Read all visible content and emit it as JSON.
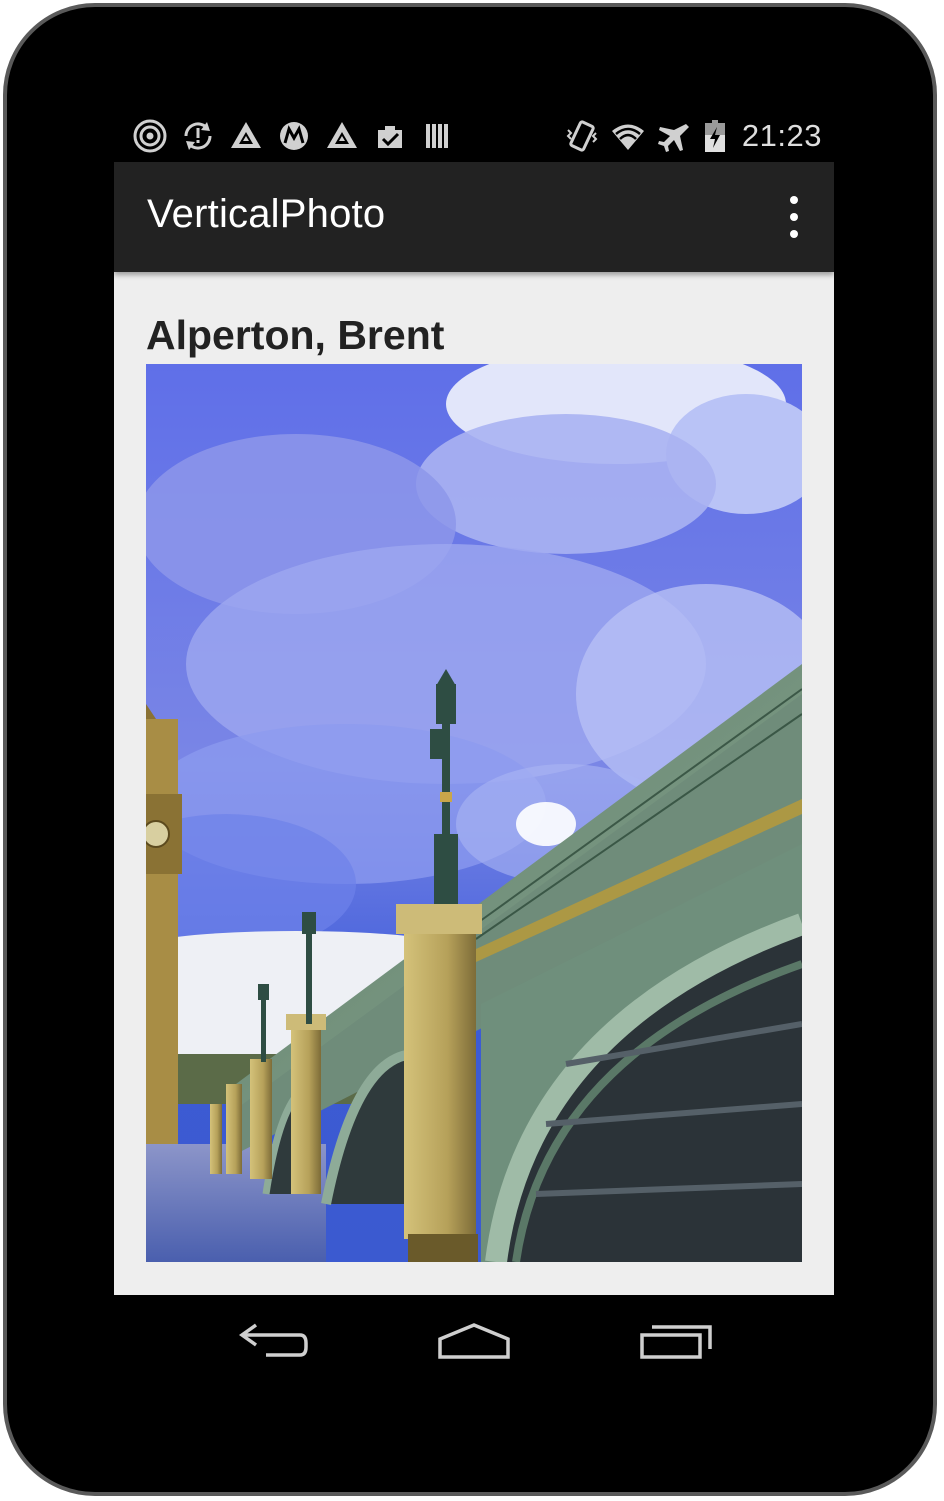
{
  "status_bar": {
    "left_icons": [
      "target-icon",
      "sync-alert-icon",
      "drive-icon",
      "motorola-icon",
      "drive-icon",
      "clipboard-check-icon",
      "barcode-icon"
    ],
    "right_icons": [
      "vibrate-icon",
      "wifi-icon",
      "airplane-mode-icon",
      "battery-charging-icon"
    ],
    "time": "21:23"
  },
  "action_bar": {
    "title": "VerticalPhoto",
    "overflow_icon": "more-vert-icon",
    "background": "#222222"
  },
  "content": {
    "place_title": "Alperton, Brent",
    "photo_subject": "westminster-bridge-photo"
  },
  "nav_bar": {
    "buttons": [
      "back-icon",
      "home-icon",
      "recent-apps-icon"
    ]
  }
}
